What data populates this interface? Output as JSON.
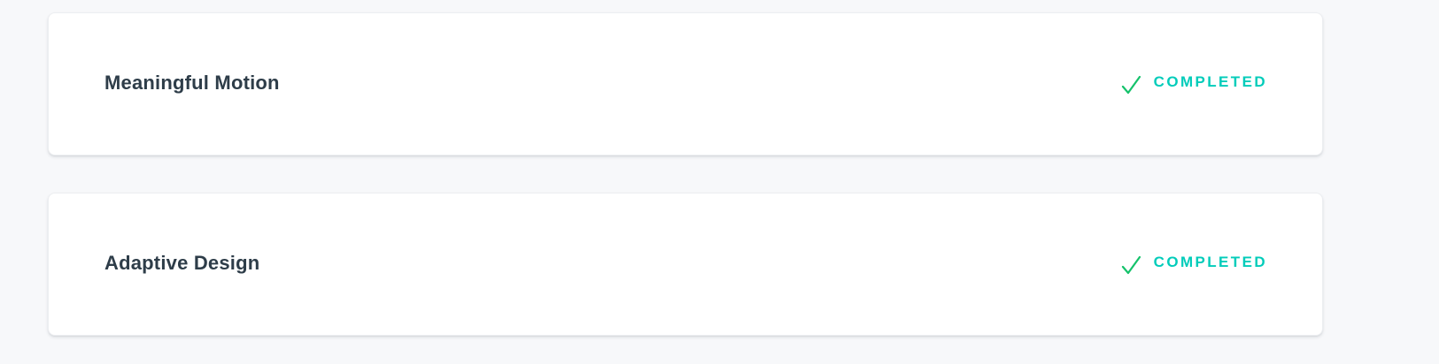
{
  "lessons": [
    {
      "title": "Meaningful Motion",
      "status": "COMPLETED"
    },
    {
      "title": "Adaptive Design",
      "status": "COMPLETED"
    }
  ],
  "icons": {
    "status": "check-icon"
  },
  "colors": {
    "background": "#f7f8fa",
    "card": "#ffffff",
    "title": "#2e3d49",
    "status_text": "#02ccba",
    "check": "#15c26b"
  }
}
